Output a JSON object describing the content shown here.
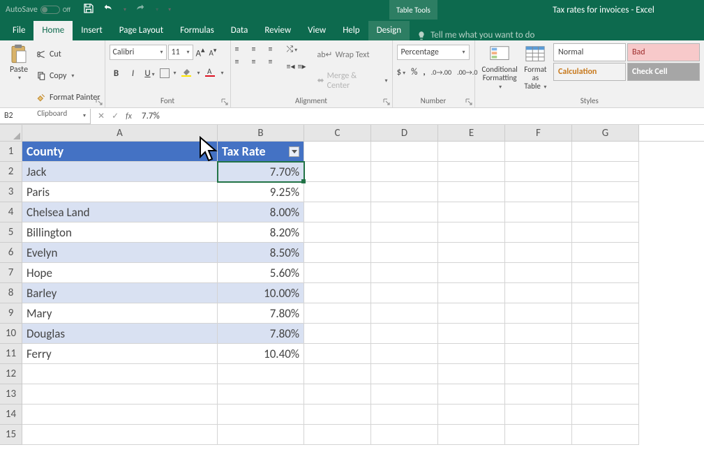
{
  "titlebar": {
    "autosave_label": "AutoSave",
    "autosave_state": "Off",
    "tabletools": "Table Tools",
    "doc_title": "Tax rates for invoices - Excel"
  },
  "tabs": {
    "file": "File",
    "home": "Home",
    "insert": "Insert",
    "pagelayout": "Page Layout",
    "formulas": "Formulas",
    "data": "Data",
    "review": "Review",
    "view": "View",
    "help": "Help",
    "design": "Design",
    "tellme": "Tell me what you want to do"
  },
  "ribbon": {
    "clipboard": {
      "paste": "Paste",
      "cut": "Cut",
      "copy": "Copy",
      "fmtpainter": "Format Painter",
      "label": "Clipboard"
    },
    "font": {
      "name": "Calibri",
      "size": "11",
      "label": "Font"
    },
    "alignment": {
      "wrap": "Wrap Text",
      "merge": "Merge & Center",
      "label": "Alignment"
    },
    "number": {
      "format": "Percentage",
      "label": "Number"
    },
    "styles": {
      "condfmt_l1": "Conditional",
      "condfmt_l2": "Formatting",
      "fmttbl_l1": "Format as",
      "fmttbl_l2": "Table",
      "normal": "Normal",
      "bad": "Bad",
      "calc": "Calculation",
      "check": "Check Cell",
      "label": "Styles"
    }
  },
  "fbar": {
    "name": "B2",
    "value": "7.7%"
  },
  "columns": [
    "A",
    "B",
    "C",
    "D",
    "E",
    "F",
    "G"
  ],
  "headers": {
    "a": "County",
    "b": "Tax Rate"
  },
  "rows": [
    {
      "n": "1"
    },
    {
      "n": "2",
      "a": "Jack",
      "b": "7.70%"
    },
    {
      "n": "3",
      "a": "Paris",
      "b": "9.25%"
    },
    {
      "n": "4",
      "a": "Chelsea Land",
      "b": "8.00%"
    },
    {
      "n": "5",
      "a": "Billington",
      "b": "8.20%"
    },
    {
      "n": "6",
      "a": "Evelyn",
      "b": "8.50%"
    },
    {
      "n": "7",
      "a": "Hope",
      "b": "5.60%"
    },
    {
      "n": "8",
      "a": "Barley",
      "b": "10.00%"
    },
    {
      "n": "9",
      "a": "Mary",
      "b": "7.80%"
    },
    {
      "n": "10",
      "a": "Douglas",
      "b": "7.80%"
    },
    {
      "n": "11",
      "a": "Ferry",
      "b": "10.40%"
    },
    {
      "n": "12"
    },
    {
      "n": "13"
    },
    {
      "n": "14"
    },
    {
      "n": "15"
    }
  ]
}
